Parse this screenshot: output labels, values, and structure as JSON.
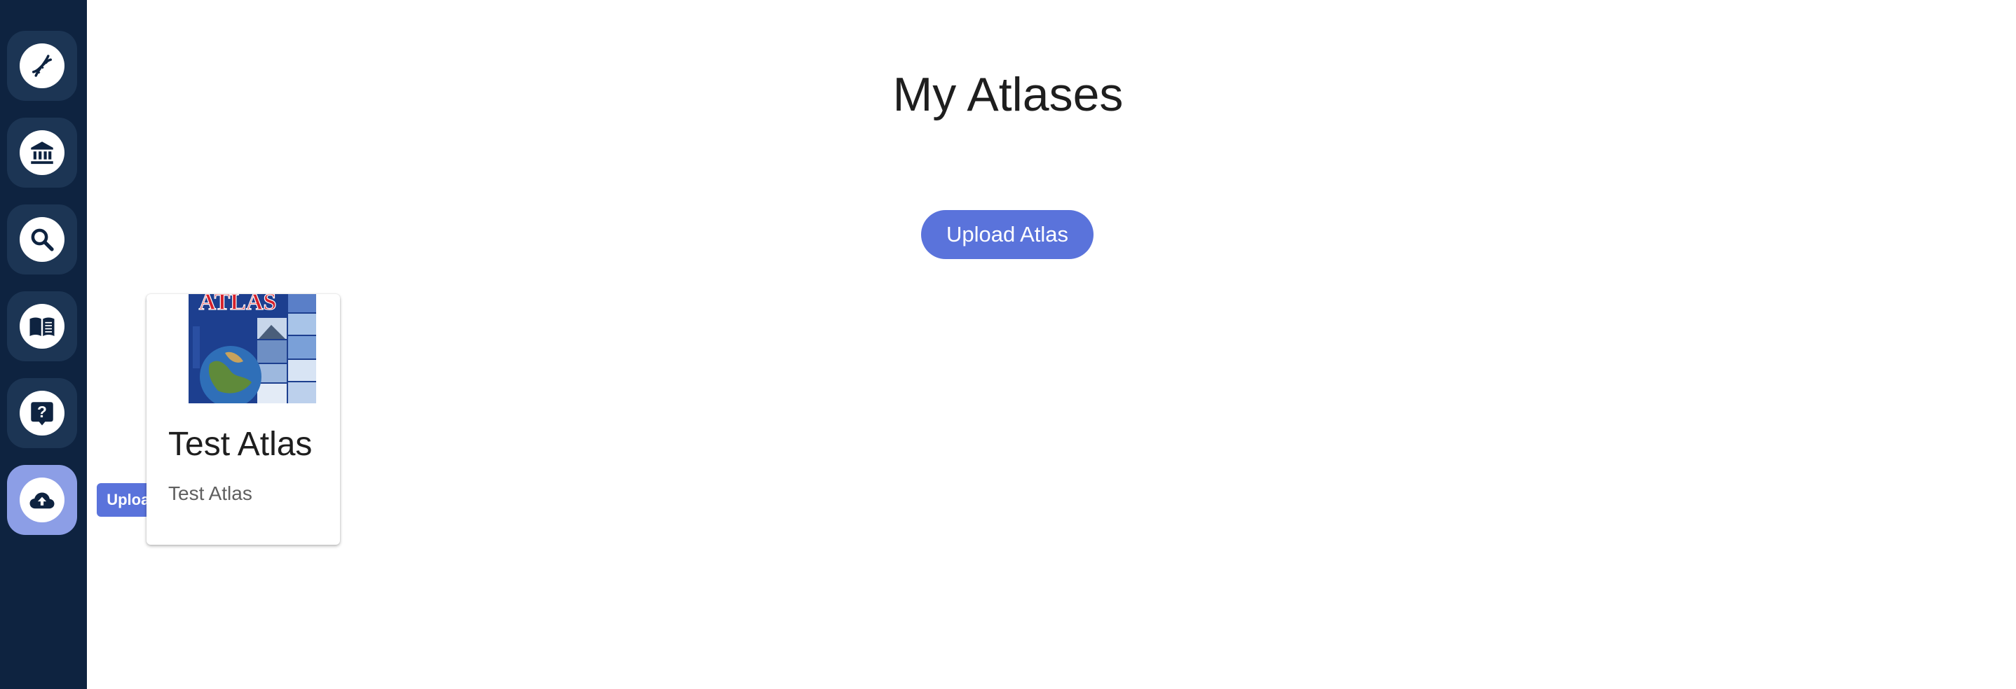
{
  "sidebar": {
    "items": [
      {
        "icon": "dna-icon"
      },
      {
        "icon": "bank-icon"
      },
      {
        "icon": "search-icon"
      },
      {
        "icon": "book-icon"
      },
      {
        "icon": "help-icon"
      },
      {
        "icon": "cloud-upload-icon",
        "active": true
      }
    ],
    "tooltip": "Upload"
  },
  "main": {
    "title": "My Atlases",
    "upload_button": "Upload Atlas",
    "atlases": [
      {
        "title": "Test Atlas",
        "description": "Test Atlas",
        "cover_text": "ATLAS"
      }
    ]
  },
  "colors": {
    "sidebar_bg": "#0e2340",
    "nav_button_bg": "#1c3554",
    "nav_active_bg": "#8c9ee6",
    "accent": "#5a73db"
  }
}
